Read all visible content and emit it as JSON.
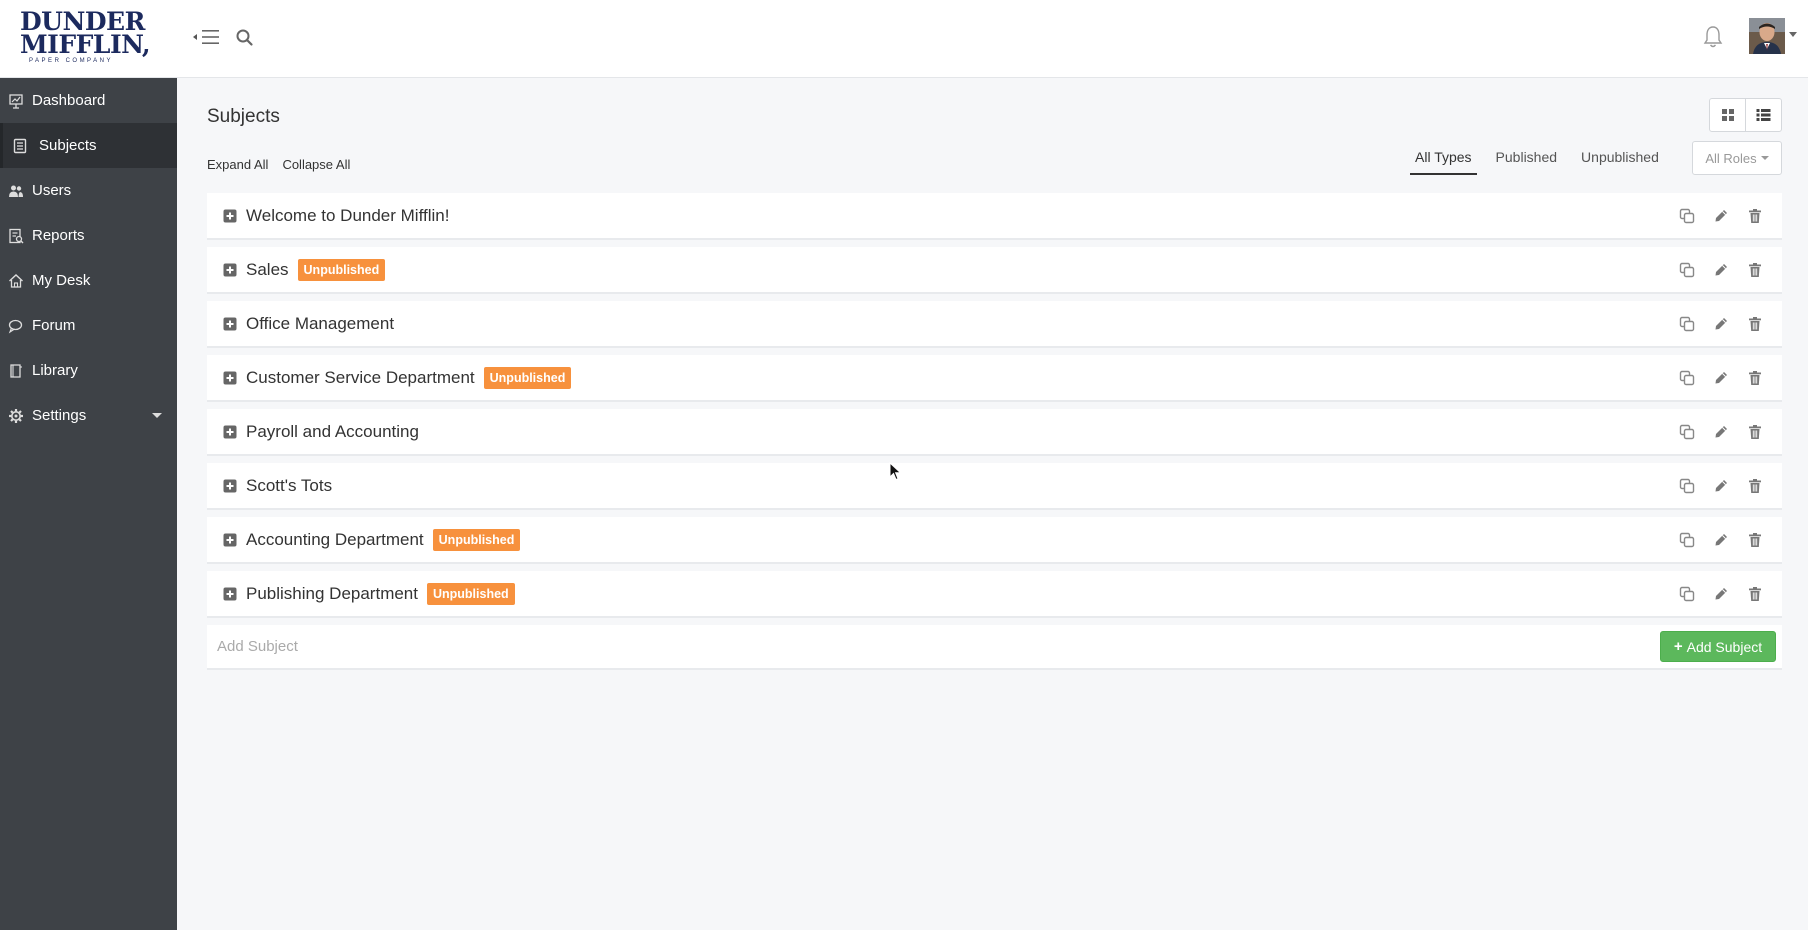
{
  "brand": {
    "line1": "DUNDER",
    "line2": "MIFFLIN,",
    "line3": "PAPER COMPANY"
  },
  "sidebar": {
    "items": [
      {
        "label": "Dashboard",
        "icon": "dashboard-icon"
      },
      {
        "label": "Subjects",
        "icon": "subjects-icon",
        "active": true
      },
      {
        "label": "Users",
        "icon": "users-icon"
      },
      {
        "label": "Reports",
        "icon": "reports-icon"
      },
      {
        "label": "My Desk",
        "icon": "home-icon"
      },
      {
        "label": "Forum",
        "icon": "forum-icon"
      },
      {
        "label": "Library",
        "icon": "library-icon"
      },
      {
        "label": "Settings",
        "icon": "gear-icon",
        "has_submenu": true
      }
    ]
  },
  "main": {
    "title": "Subjects",
    "expand_all": "Expand All",
    "collapse_all": "Collapse All",
    "filters": [
      "All Types",
      "Published",
      "Unpublished"
    ],
    "active_filter": "All Types",
    "roles_label": "All Roles",
    "unpublished_label": "Unpublished",
    "subjects": [
      {
        "name": "Welcome to Dunder Mifflin!",
        "unpublished": false
      },
      {
        "name": "Sales",
        "unpublished": true
      },
      {
        "name": "Office Management",
        "unpublished": false
      },
      {
        "name": "Customer Service Department",
        "unpublished": true
      },
      {
        "name": "Payroll and Accounting",
        "unpublished": false
      },
      {
        "name": "Scott's Tots",
        "unpublished": false
      },
      {
        "name": "Accounting Department",
        "unpublished": true
      },
      {
        "name": "Publishing Department",
        "unpublished": true
      }
    ],
    "add_placeholder": "Add Subject",
    "add_button": "Add Subject"
  },
  "colors": {
    "sidebar_bg": "#3e4247",
    "badge": "#f7913d",
    "add_button": "#5cb85c",
    "brand_navy": "#1c2a5e"
  }
}
